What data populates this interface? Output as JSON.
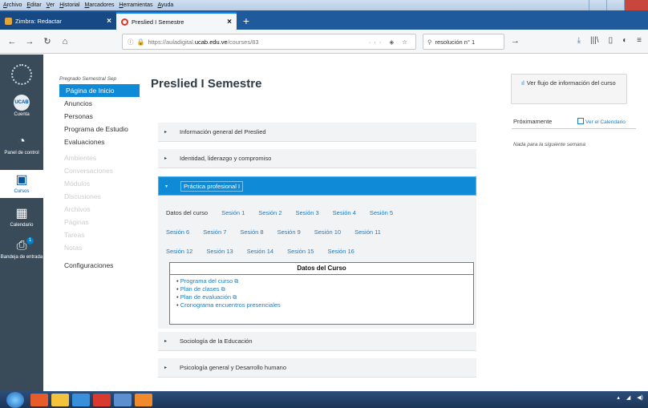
{
  "browser": {
    "menu": [
      "Archivo",
      "Editar",
      "Ver",
      "Historial",
      "Marcadores",
      "Herramientas",
      "Ayuda"
    ],
    "tabs": [
      {
        "label": "Zimbra: Redactar",
        "active": false
      },
      {
        "label": "Preslied I Semestre",
        "active": true
      }
    ],
    "url_prefix": "https://auladigital.",
    "url_domain": "ucab.edu.ve",
    "url_path": "/courses/83",
    "search_value": "resolución n° 1"
  },
  "global_nav": {
    "items": [
      {
        "label": "Cuenta",
        "icon": "user-avatar-icon",
        "avatar_text": "UCAB"
      },
      {
        "label": "Panel de control",
        "icon": "dashboard-icon"
      },
      {
        "label": "Cursos",
        "icon": "book-icon"
      },
      {
        "label": "Calendario",
        "icon": "calendar-icon"
      },
      {
        "label": "Bandeja de entrada",
        "icon": "inbox-icon",
        "badge": "1"
      }
    ]
  },
  "course_nav": {
    "term": "Pregrado Semestral Sep",
    "items": [
      {
        "label": "Página de Inicio",
        "state": "active"
      },
      {
        "label": "Anuncios",
        "state": "normal"
      },
      {
        "label": "Personas",
        "state": "normal"
      },
      {
        "label": "Programa de Estudio",
        "state": "normal"
      },
      {
        "label": "Evaluaciones",
        "state": "normal"
      },
      {
        "label": "Ambientes",
        "state": "faded"
      },
      {
        "label": "Conversaciones",
        "state": "faded"
      },
      {
        "label": "Módulos",
        "state": "faded"
      },
      {
        "label": "Discusiones",
        "state": "faded"
      },
      {
        "label": "Archivos",
        "state": "faded"
      },
      {
        "label": "Páginas",
        "state": "faded"
      },
      {
        "label": "Tareas",
        "state": "faded"
      },
      {
        "label": "Notas",
        "state": "faded"
      },
      {
        "label": "Configuraciones",
        "state": "normal"
      }
    ]
  },
  "main": {
    "title": "Preslied I Semestre",
    "modules": [
      {
        "label": "Información general del Preslied"
      },
      {
        "label": "Identidad, liderazgo y compromiso"
      },
      {
        "label": "Práctica profesional I"
      },
      {
        "label": "Sociología de la Educación"
      },
      {
        "label": "Psicología general y Desarrollo humano"
      }
    ],
    "session_rows": [
      [
        "Datos del curso",
        "Sesión 1",
        "Sesión 2",
        "Sesión 3",
        "Sesión 4",
        "Sesión 5"
      ],
      [
        "Sesión 6",
        "Sesión 7",
        "Sesión 8",
        "Sesión 9",
        "Sesión 10",
        "Sesión 11"
      ],
      [
        "Sesión 12",
        "Sesión 13",
        "Sesión 14",
        "Sesión 15",
        "Sesión 16"
      ]
    ],
    "datos": {
      "title": "Datos del Curso",
      "links": [
        "Programa del curso",
        "Plan de clases",
        "Plan de evaluación",
        "Cronograma encuentros presenciales"
      ]
    }
  },
  "sidebar": {
    "flujo_label": "Ver flujo de información del curso",
    "proximamente": "Próximamente",
    "ver_calendario": "Ver el Calendario",
    "nada": "Nada para la siguiente semana"
  },
  "colors": {
    "canvas_nav": "#394b58",
    "accent": "#0e8ad6",
    "link": "#1a7cc5",
    "firefox_tabstrip": "#1f5a9c"
  }
}
